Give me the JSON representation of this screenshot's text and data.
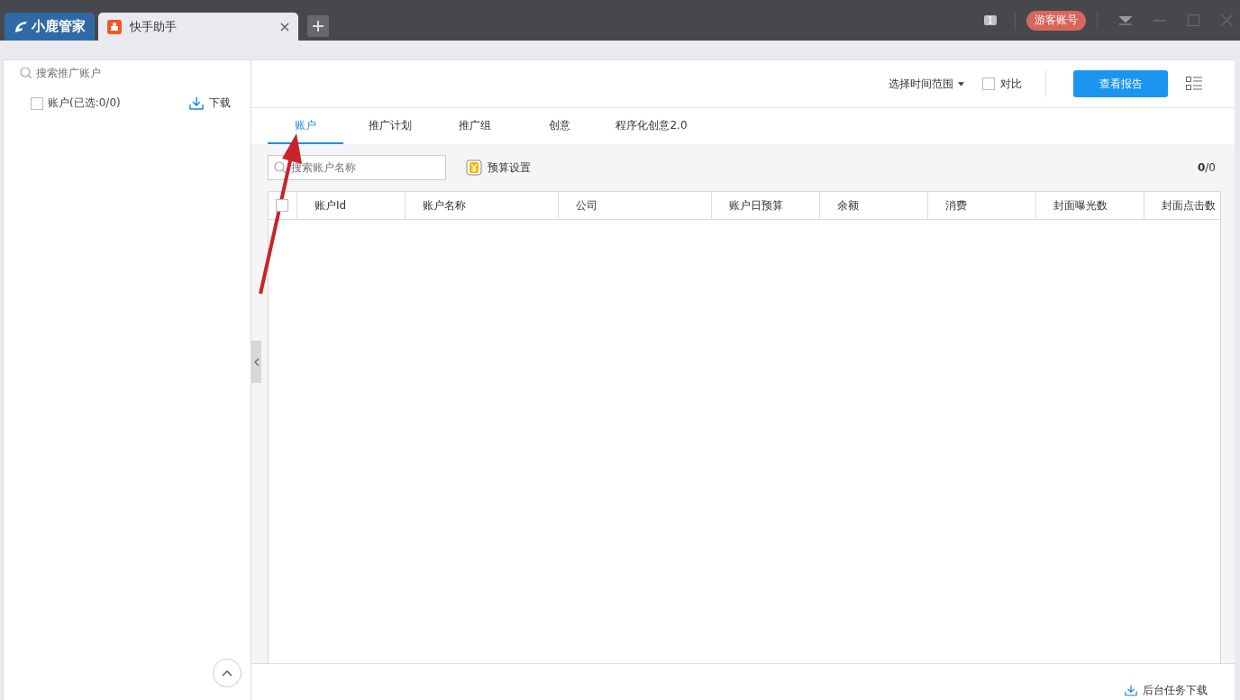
{
  "titlebar": {
    "logo": "小鹿管家",
    "tabs": [
      {
        "label": "快手助手",
        "selected": true
      }
    ],
    "counter": "1",
    "account_badge": "游客账号"
  },
  "sidebar": {
    "search": {
      "placeholder": "搜索推广账户"
    },
    "account_row": {
      "label": "账户(已选:0/0)",
      "checked": false
    },
    "download": "下载"
  },
  "header": {
    "time_range": "选择时间范围",
    "compare": {
      "label": "对比",
      "checked": false
    },
    "report_button": "查看报告"
  },
  "tabs": [
    {
      "label": "账户",
      "selected": true
    },
    {
      "label": "推广计划",
      "selected": false
    },
    {
      "label": "推广组",
      "selected": false
    },
    {
      "label": "创意",
      "selected": false
    },
    {
      "label": "程序化创意2.0",
      "selected": false
    }
  ],
  "toolbar": {
    "search": {
      "placeholder": "搜索账户名称"
    },
    "budget": "预算设置",
    "count": "**0**/0"
  },
  "table": {
    "all_checked": false,
    "columns": [
      "账户Id",
      "账户名称",
      "公司",
      "账户日预算",
      "余额",
      "消费",
      "封面曝光数",
      "封面点击数"
    ]
  },
  "footer": {
    "download_tasks": "后台任务下载"
  }
}
